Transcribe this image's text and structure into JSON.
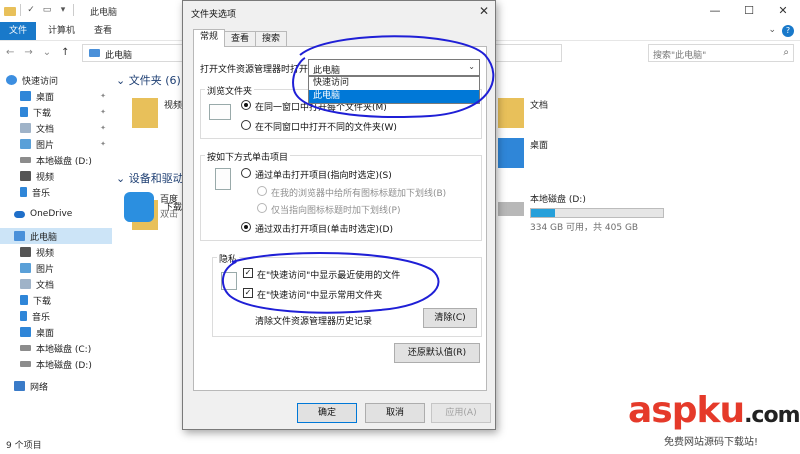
{
  "explorer": {
    "title": "此电脑",
    "ribbon_tabs": [
      "文件",
      "计算机",
      "查看"
    ],
    "address": "此电脑",
    "search_placeholder": "搜索\"此电脑\"",
    "sidebar": {
      "items": [
        "快速访问",
        "桌面",
        "下载",
        "文档",
        "图片",
        "本地磁盘 (D:)",
        "视频",
        "音乐",
        "OneDrive",
        "此电脑",
        "视频",
        "图片",
        "文档",
        "下载",
        "音乐",
        "桌面",
        "本地磁盘 (C:)",
        "本地磁盘 (D:)",
        "网络"
      ]
    },
    "folders_header": "文件夹 (6)",
    "folders": [
      "视频",
      "下载",
      "文档",
      "桌面"
    ],
    "devices_header": "设备和驱动",
    "baidu": {
      "name": "百度",
      "sub": "双击"
    },
    "drive_d": {
      "name": "本地磁盘 (D:)",
      "free": "334 GB 可用，共 405 GB",
      "used_fraction": 0.18
    },
    "status": "9 个项目",
    "colors": {
      "accent": "#1979ca",
      "drive_bar": "#26a0da",
      "annotation": "#1f1fd6"
    }
  },
  "dialog": {
    "title": "文件夹选项",
    "tabs": [
      "常规",
      "查看",
      "搜索"
    ],
    "open_label": "打开文件资源管理器时打开：",
    "combo_value": "此电脑",
    "combo_options": [
      "快速访问",
      "此电脑"
    ],
    "browse_group": "浏览文件夹",
    "browse_opt1": "在同一窗口中打开每个文件夹(M)",
    "browse_opt2": "在不同窗口中打开不同的文件夹(W)",
    "click_group": "按如下方式单击项目",
    "click_opt1": "通过单击打开项目(指向时选定)(S)",
    "click_sub1": "在我的浏览器中给所有图标标题加下划线(B)",
    "click_sub2": "仅当指向图标标题时加下划线(P)",
    "click_opt2": "通过双击打开项目(单击时选定)(D)",
    "privacy_group": "隐私",
    "privacy_chk1": "在\"快速访问\"中显示最近使用的文件",
    "privacy_chk2": "在\"快速访问\"中显示常用文件夹",
    "clear_label": "清除文件资源管理器历史记录",
    "clear_btn": "清除(C)",
    "restore_btn": "还原默认值(R)",
    "ok_btn": "确定",
    "cancel_btn": "取消",
    "apply_btn": "应用(A)"
  },
  "watermark": {
    "asp": "asp",
    "ku": "ku",
    "com": ".com",
    "sub": "免费网站源码下载站!"
  }
}
